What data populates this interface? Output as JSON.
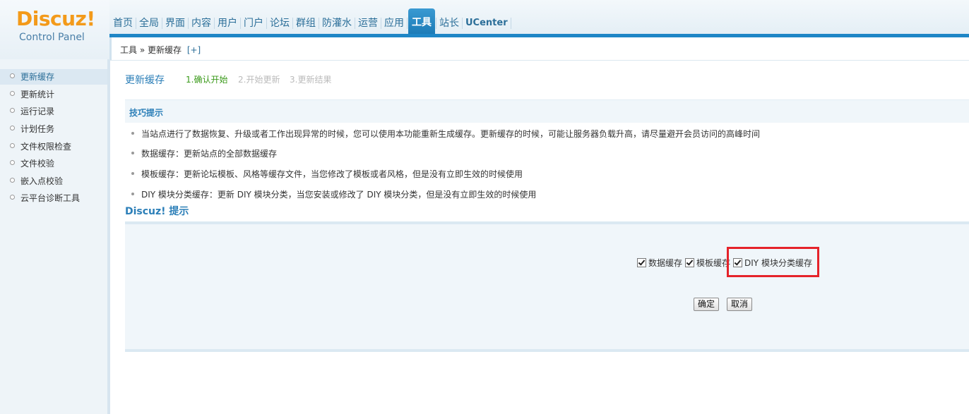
{
  "logo": {
    "title": "Discuz!",
    "subtitle": "Control Panel"
  },
  "nav": {
    "items": [
      "首页",
      "全局",
      "界面",
      "内容",
      "用户",
      "门户",
      "论坛",
      "群组",
      "防灌水",
      "运营",
      "应用",
      "工具",
      "站长",
      "UCenter"
    ],
    "active": "工具"
  },
  "breadcrumb": {
    "text": "工具 » 更新缓存",
    "add": "[+]"
  },
  "sidebar": {
    "items": [
      {
        "label": "更新缓存",
        "active": true
      },
      {
        "label": "更新统计"
      },
      {
        "label": "运行记录"
      },
      {
        "label": "计划任务"
      },
      {
        "label": "文件权限检查"
      },
      {
        "label": "文件校验"
      },
      {
        "label": "嵌入点校验"
      },
      {
        "label": "云平台诊断工具"
      }
    ]
  },
  "main": {
    "title": "更新缓存",
    "steps": [
      "1.确认开始",
      "2.开始更新",
      "3.更新结果"
    ],
    "tips_title": "技巧提示",
    "tips": [
      "当站点进行了数据恢复、升级或者工作出现异常的时候，您可以使用本功能重新生成缓存。更新缓存的时候，可能让服务器负载升高，请尽量避开会员访问的高峰时间",
      "数据缓存：更新站点的全部数据缓存",
      "模板缓存：更新论坛模板、风格等缓存文件，当您修改了模板或者风格，但是没有立即生效的时候使用",
      "DIY 模块分类缓存：更新 DIY 模块分类，当您安装或修改了 DIY 模块分类，但是没有立即生效的时候使用"
    ],
    "hint_title": "Discuz! 提示",
    "checkboxes": [
      {
        "label": "数据缓存",
        "checked": true
      },
      {
        "label": "模板缓存",
        "checked": true
      },
      {
        "label": "DIY 模块分类缓存",
        "checked": true
      }
    ],
    "confirm_label": "确定",
    "cancel_label": "取消"
  },
  "colors": {
    "accent": "#1e86c6",
    "highlight": "#e5232a",
    "logo": "#f39a1a"
  }
}
